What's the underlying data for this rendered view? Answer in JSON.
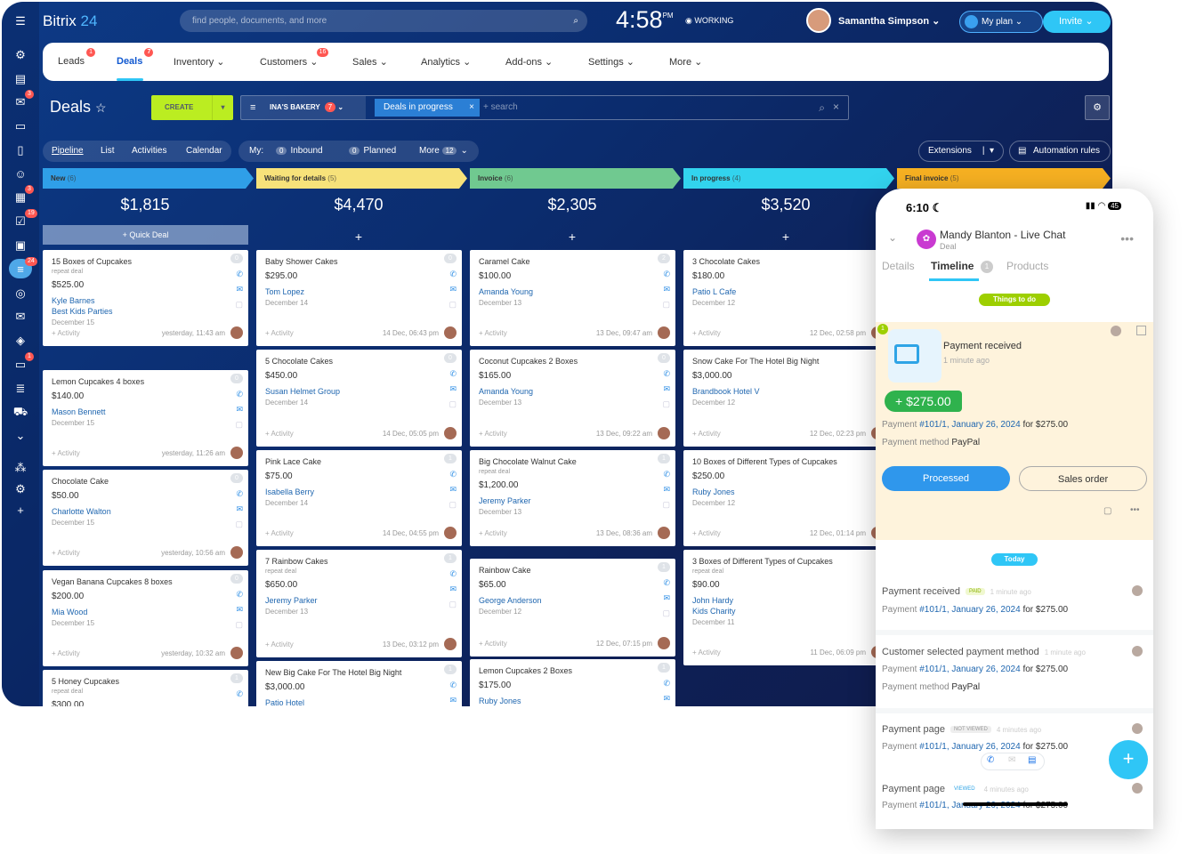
{
  "app": {
    "logo_a": "Bitrix",
    "logo_b": "24",
    "search_placeholder": "find people, documents, and more",
    "time": "4:58",
    "ampm": "PM",
    "status": "WORKING",
    "user": "Samantha Simpson",
    "my_plan": "My plan",
    "invite": "Invite"
  },
  "sidebar_badges": [
    "3",
    "3",
    "19",
    "24",
    "1"
  ],
  "nav": [
    {
      "label": "Leads",
      "badge": "1"
    },
    {
      "label": "Deals",
      "badge": "7"
    },
    {
      "label": "Inventory ⌄",
      "badge": ""
    },
    {
      "label": "Customers ⌄",
      "badge": "16"
    },
    {
      "label": "Sales ⌄",
      "badge": ""
    },
    {
      "label": "Analytics ⌄",
      "badge": ""
    },
    {
      "label": "Add-ons ⌄",
      "badge": ""
    },
    {
      "label": "Settings ⌄",
      "badge": ""
    },
    {
      "label": "More ⌄",
      "badge": ""
    }
  ],
  "toolbar": {
    "title": "Deals",
    "create": "CREATE",
    "filter_name": "INA'S BAKERY",
    "filter_count": "7",
    "filter_tag": "Deals in progress",
    "search": "+ search"
  },
  "views": [
    "Pipeline",
    "List",
    "Activities",
    "Calendar"
  ],
  "my": {
    "label": "My:",
    "inbound_count": "0",
    "inbound": "Inbound",
    "planned_count": "0",
    "planned": "Planned",
    "more": "More",
    "more_count": "12"
  },
  "extensions": "Extensions",
  "automation": "Automation rules",
  "quick_deal": "+ Quick Deal",
  "columns": [
    {
      "name": "New",
      "count": "(6)",
      "sum": "$1,815",
      "color": "#2f9fe8"
    },
    {
      "name": "Waiting for details",
      "count": "(5)",
      "sum": "$4,470",
      "color": "#f7e27a"
    },
    {
      "name": "Invoice",
      "count": "(6)",
      "sum": "$2,305",
      "color": "#70c990"
    },
    {
      "name": "In progress",
      "count": "(4)",
      "sum": "$3,520",
      "color": "#32d3ee"
    },
    {
      "name": "Final invoice",
      "count": "(5)",
      "sum": "",
      "color": "#f7b122"
    }
  ],
  "cards": [
    [
      {
        "title": "15 Boxes of Cupcakes",
        "repeat": "repeat deal",
        "price": "$525.00",
        "links": [
          "Kyle Barnes",
          "Best Kids Parties"
        ],
        "date": "December 15",
        "activity": "+ Activity",
        "ts": "yesterday, 11:43 am",
        "count": "0"
      },
      {
        "title": "Lemon Cupcakes 4 boxes",
        "repeat": "",
        "price": "$140.00",
        "links": [
          "Mason Bennett"
        ],
        "date": "December 15",
        "activity": "+ Activity",
        "ts": "yesterday, 11:26 am",
        "count": "0"
      },
      {
        "title": "Chocolate Cake",
        "repeat": "",
        "price": "$50.00",
        "links": [
          "Charlotte Walton"
        ],
        "date": "December 15",
        "activity": "+ Activity",
        "ts": "yesterday, 10:56 am",
        "count": "0"
      },
      {
        "title": "Vegan Banana Cupcakes 8 boxes",
        "repeat": "",
        "price": "$200.00",
        "links": [
          "Mia Wood"
        ],
        "date": "December 15",
        "activity": "+ Activity",
        "ts": "yesterday, 10:32 am",
        "count": "0"
      },
      {
        "title": "5 Honey Cupcakes",
        "repeat": "repeat deal",
        "price": "$300.00",
        "links": [],
        "date": "",
        "activity": "",
        "ts": "",
        "count": "1"
      }
    ],
    [
      {
        "title": "Baby Shower Cakes",
        "repeat": "",
        "price": "$295.00",
        "links": [
          "Tom Lopez"
        ],
        "date": "December 14",
        "activity": "+ Activity",
        "ts": "14 Dec, 06:43 pm",
        "count": "0"
      },
      {
        "title": "5 Chocolate Cakes",
        "repeat": "",
        "price": "$450.00",
        "links": [
          "Susan Helmet Group"
        ],
        "date": "December 14",
        "activity": "+ Activity",
        "ts": "14 Dec, 05:05 pm",
        "count": "0"
      },
      {
        "title": "Pink Lace Cake",
        "repeat": "",
        "price": "$75.00",
        "links": [
          "Isabella Berry"
        ],
        "date": "December 14",
        "activity": "+ Activity",
        "ts": "14 Dec, 04:55 pm",
        "count": "1"
      },
      {
        "title": "7 Rainbow Cakes",
        "repeat": "repeat deal",
        "price": "$650.00",
        "links": [
          "Jeremy Parker"
        ],
        "date": "December 13",
        "activity": "+ Activity",
        "ts": "13 Dec, 03:12 pm",
        "count": "1"
      },
      {
        "title": "New Big Cake For The Hotel Big Night",
        "repeat": "",
        "price": "$3,000.00",
        "links": [
          "Patio Hotel"
        ],
        "date": "",
        "activity": "",
        "ts": "",
        "count": "1"
      }
    ],
    [
      {
        "title": "Caramel Cake",
        "repeat": "",
        "price": "$100.00",
        "links": [
          "Amanda Young"
        ],
        "date": "December 13",
        "activity": "+ Activity",
        "ts": "13 Dec, 09:47 am",
        "count": "2"
      },
      {
        "title": "Coconut Cupcakes 2 Boxes",
        "repeat": "",
        "price": "$165.00",
        "links": [
          "Amanda Young"
        ],
        "date": "December 13",
        "activity": "+ Activity",
        "ts": "13 Dec, 09:22 am",
        "count": "0"
      },
      {
        "title": "Big Chocolate Walnut Cake",
        "repeat": "repeat deal",
        "price": "$1,200.00",
        "links": [
          "Jeremy Parker"
        ],
        "date": "December 13",
        "activity": "+ Activity",
        "ts": "13 Dec, 08:36 am",
        "count": "1"
      },
      {
        "title": "Rainbow Cake",
        "repeat": "",
        "price": "$65.00",
        "links": [
          "George Anderson"
        ],
        "date": "December 12",
        "activity": "+ Activity",
        "ts": "12 Dec, 07:15 pm",
        "count": "1"
      },
      {
        "title": "Lemon Cupcakes 2 Boxes",
        "repeat": "",
        "price": "$175.00",
        "links": [
          "Ruby Jones"
        ],
        "date": "",
        "activity": "",
        "ts": "",
        "count": "1"
      }
    ],
    [
      {
        "title": "3 Chocolate Cakes",
        "repeat": "",
        "price": "$180.00",
        "links": [
          "Patio L Cafe"
        ],
        "date": "December 12",
        "activity": "+ Activity",
        "ts": "12 Dec, 02:58 pm",
        "count": ""
      },
      {
        "title": "Snow Cake For The Hotel Big Night",
        "repeat": "",
        "price": "$3,000.00",
        "links": [
          "Brandbook Hotel V"
        ],
        "date": "December 12",
        "activity": "+ Activity",
        "ts": "12 Dec, 02:23 pm",
        "count": ""
      },
      {
        "title": "10 Boxes of Different Types of Cupcakes",
        "repeat": "",
        "price": "$250.00",
        "links": [
          "Ruby Jones"
        ],
        "date": "December 12",
        "activity": "+ Activity",
        "ts": "12 Dec, 01:14 pm",
        "count": ""
      },
      {
        "title": "3 Boxes of Different Types of Cupcakes",
        "repeat": "repeat deal",
        "price": "$90.00",
        "links": [
          "John Hardy",
          "Kids Charity"
        ],
        "date": "December 11",
        "activity": "+ Activity",
        "ts": "11 Dec, 06:09 pm",
        "count": ""
      }
    ]
  ],
  "phone": {
    "time": "6:10",
    "battery": "45",
    "name": "Mandy Blanton - Live Chat",
    "sub": "Deal",
    "tabs": [
      "Details",
      "Timeline",
      "Products"
    ],
    "tab_count": "1",
    "todo": "Things to do",
    "pr_title": "Payment received",
    "pr_time": "1 minute ago",
    "amount": "+ $275.00",
    "pay_prefix": "Payment",
    "pay_link": "#101/1, January 26, 2024",
    "pay_suffix": "for $275.00",
    "method_label": "Payment method",
    "method": "PayPal",
    "processed": "Processed",
    "sales_order": "Sales order",
    "today": "Today",
    "e1": "Payment received",
    "e1_tag": "PAID",
    "e1_time": "1 minute ago",
    "e2": "Customer selected payment method",
    "e2_time": "1 minute ago",
    "e3": "Payment page",
    "e3_tag": "NOT VIEWED",
    "e3_time": "4 minutes ago",
    "e4": "Payment page",
    "e4_tag": "VIEWED",
    "e4_time": "4 minutes ago"
  }
}
